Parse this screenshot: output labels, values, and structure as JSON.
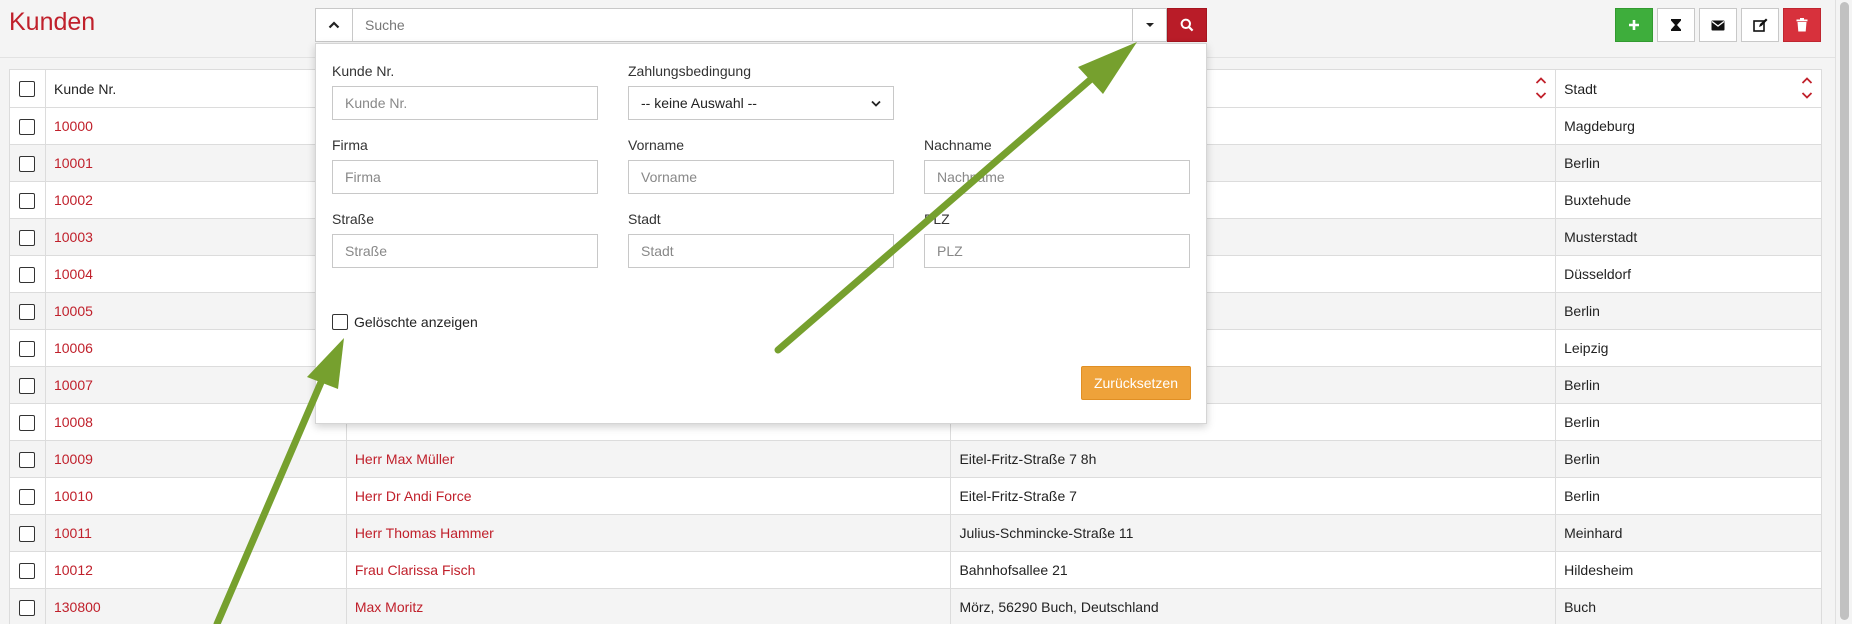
{
  "page": {
    "title": "Kunden"
  },
  "search": {
    "placeholder": "Suche"
  },
  "table": {
    "headers": [
      "Kunde Nr.",
      "Stadt"
    ],
    "rows": [
      {
        "nr": "10000",
        "name": "",
        "street": "",
        "city": "Magdeburg"
      },
      {
        "nr": "10001",
        "name": "",
        "street": "",
        "city": "Berlin"
      },
      {
        "nr": "10002",
        "name": "",
        "street": "",
        "city": "Buxtehude"
      },
      {
        "nr": "10003",
        "name": "",
        "street": "",
        "city": "Musterstadt"
      },
      {
        "nr": "10004",
        "name": "",
        "street": "",
        "city": "Düsseldorf"
      },
      {
        "nr": "10005",
        "name": "",
        "street": "",
        "city": "Berlin"
      },
      {
        "nr": "10006",
        "name": "",
        "street": "",
        "city": "Leipzig"
      },
      {
        "nr": "10007",
        "name": "",
        "street": "",
        "city": "Berlin"
      },
      {
        "nr": "10008",
        "name": "",
        "street": "",
        "city": "Berlin"
      },
      {
        "nr": "10009",
        "name": "Herr Max Müller",
        "street": "Eitel-Fritz-Straße 7 8h",
        "city": "Berlin"
      },
      {
        "nr": "10010",
        "name": "Herr Dr Andi Force",
        "street": "Eitel-Fritz-Straße 7",
        "city": "Berlin"
      },
      {
        "nr": "10011",
        "name": "Herr Thomas Hammer",
        "street": "Julius-Schmincke-Straße 11",
        "city": "Meinhard"
      },
      {
        "nr": "10012",
        "name": "Frau Clarissa Fisch",
        "street": "Bahnhofsallee 21",
        "city": "Hildesheim"
      },
      {
        "nr": "130800",
        "name": "Max Moritz",
        "street": "Mörz, 56290 Buch, Deutschland",
        "city": "Buch"
      }
    ]
  },
  "filter": {
    "kunde_nr": {
      "label": "Kunde Nr.",
      "placeholder": "Kunde Nr."
    },
    "zahlungsbedingung": {
      "label": "Zahlungsbedingung",
      "selected": "-- keine Auswahl --"
    },
    "firma": {
      "label": "Firma",
      "placeholder": "Firma"
    },
    "vorname": {
      "label": "Vorname",
      "placeholder": "Vorname"
    },
    "nachname": {
      "label": "Nachname",
      "placeholder": "Nachname"
    },
    "strasse": {
      "label": "Straße",
      "placeholder": "Straße"
    },
    "stadt": {
      "label": "Stadt",
      "placeholder": "Stadt"
    },
    "plz": {
      "label": "PLZ",
      "placeholder": "PLZ"
    },
    "show_deleted": "Gelöschte anzeigen",
    "reset_label": "Zurücksetzen"
  },
  "colors": {
    "brand_red": "#c0202b",
    "add_green": "#3eae3c",
    "reset_orange": "#eea23a",
    "annotation_green": "#76a02e"
  },
  "icons": [
    "chevron-up-icon",
    "caret-down-icon",
    "search-icon",
    "plus-icon",
    "hourglass-icon",
    "envelope-icon",
    "edit-icon",
    "trash-icon",
    "sort-icon"
  ]
}
